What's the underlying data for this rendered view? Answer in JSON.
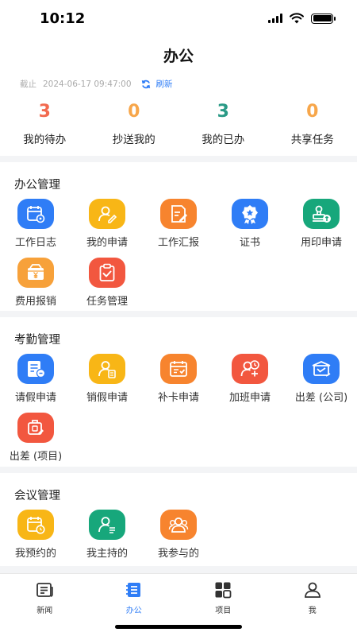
{
  "status_bar": {
    "time": "10:12"
  },
  "header": {
    "title": "办公",
    "deadline_label": "截止",
    "deadline_time": "2024-06-17 09:47:00",
    "refresh_label": "刷新"
  },
  "stats": [
    {
      "value": "3",
      "label": "我的待办",
      "color": "#f26a4f"
    },
    {
      "value": "0",
      "label": "抄送我的",
      "color": "#f7a64a"
    },
    {
      "value": "3",
      "label": "我的已办",
      "color": "#2a9a86"
    },
    {
      "value": "0",
      "label": "共享任务",
      "color": "#f7a64a"
    }
  ],
  "sections": {
    "office": {
      "title": "办公管理",
      "items": [
        {
          "label": "工作日志",
          "icon": "calendar-gear-icon",
          "color": "#2f7df6"
        },
        {
          "label": "我的申请",
          "icon": "user-edit-icon",
          "color": "#f8b616"
        },
        {
          "label": "工作汇报",
          "icon": "report-edit-icon",
          "color": "#f7842e"
        },
        {
          "label": "证书",
          "icon": "certificate-badge-icon",
          "color": "#2f7df6"
        },
        {
          "label": "用印申请",
          "icon": "seal-icon",
          "color": "#17a77b"
        },
        {
          "label": "费用报销",
          "icon": "expense-yen-icon",
          "color": "#f7a13a"
        },
        {
          "label": "任务管理",
          "icon": "clipboard-check-icon",
          "color": "#f2573f"
        }
      ]
    },
    "attendance": {
      "title": "考勤管理",
      "items": [
        {
          "label": "请假申请",
          "icon": "leave-request-icon",
          "color": "#2f7df6"
        },
        {
          "label": "销假申请",
          "icon": "leave-cancel-icon",
          "color": "#f8b616"
        },
        {
          "label": "补卡申请",
          "icon": "clock-card-icon",
          "color": "#f7842e"
        },
        {
          "label": "加班申请",
          "icon": "overtime-icon",
          "color": "#f2573f"
        },
        {
          "label": "出差 (公司)",
          "icon": "business-trip-icon",
          "color": "#2f7df6"
        },
        {
          "label": "出差 (项目)",
          "icon": "project-trip-icon",
          "color": "#f2573f"
        }
      ]
    },
    "meeting": {
      "title": "会议管理",
      "items": [
        {
          "label": "我预约的",
          "icon": "calendar-clock-icon",
          "color": "#f8b616"
        },
        {
          "label": "我主持的",
          "icon": "host-user-icon",
          "color": "#17a77b"
        },
        {
          "label": "我参与的",
          "icon": "group-users-icon",
          "color": "#f7842e"
        }
      ]
    }
  },
  "tabbar": [
    {
      "label": "新闻",
      "icon": "news-icon"
    },
    {
      "label": "办公",
      "icon": "office-icon",
      "active": true,
      "active_color": "#2f7df6"
    },
    {
      "label": "项目",
      "icon": "project-grid-icon"
    },
    {
      "label": "我",
      "icon": "profile-icon"
    }
  ]
}
